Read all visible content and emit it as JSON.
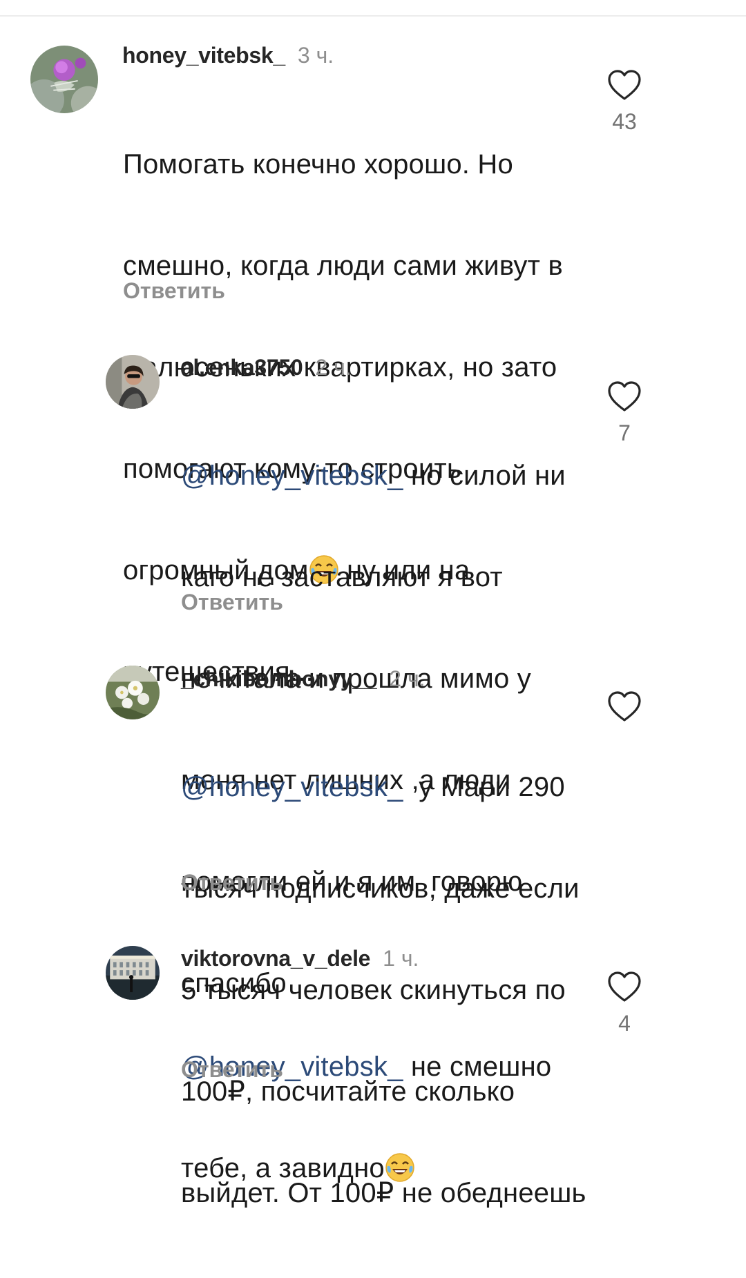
{
  "comments": [
    {
      "username": "honey_vitebsk_",
      "time": "3 ч.",
      "text_lines": [
        "Помогать конечно хорошо. Но",
        "смешно, когда люди сами живут в",
        "малюсеньких квартирках, но зато",
        "помогают кому-то строить",
        "огромный дом",
        " ну или на",
        "путешествия..."
      ],
      "emoji": "face-with-tears-of-joy",
      "reply_label": "Ответить",
      "likes": "43"
    },
    {
      "username": "al.enka3750",
      "time": "2 ч.",
      "mention": "@honey_vitebsk_",
      "text_lines": [
        " но силой ни",
        "каго не заставляют я вот",
        "почитала и прошла мимо у",
        "меня нет лишних ,а люди",
        "помогли ей и я им  говорю",
        "спасибо"
      ],
      "reply_label": "Ответить",
      "likes": "7"
    },
    {
      "username": "_chikibombonyy__",
      "time": "2 ч.",
      "mention": "@honey_vitebsk_",
      "text_lines": [
        "  у Мари 290",
        "тысяч подписчиков, даже если",
        "5 тысяч человек скинуться по",
        "100₽, посчитайте сколько",
        "выйдет. От 100₽ не обеднеешь"
      ],
      "reply_label": "Ответить",
      "likes": ""
    },
    {
      "username": "viktorovna_v_dele",
      "time": "1 ч.",
      "mention": "@honey_vitebsk_",
      "text_lines": [
        " не смешно",
        "тебе, а завидно"
      ],
      "emoji": "face-with-tears-of-joy",
      "reply_label": "Ответить",
      "likes": "4"
    }
  ],
  "icons": {
    "like": "heart-outline-icon"
  },
  "colors": {
    "mention": "#2c4a78",
    "secondary_text": "#8e8e8e",
    "primary_text": "#1a1a1a"
  }
}
